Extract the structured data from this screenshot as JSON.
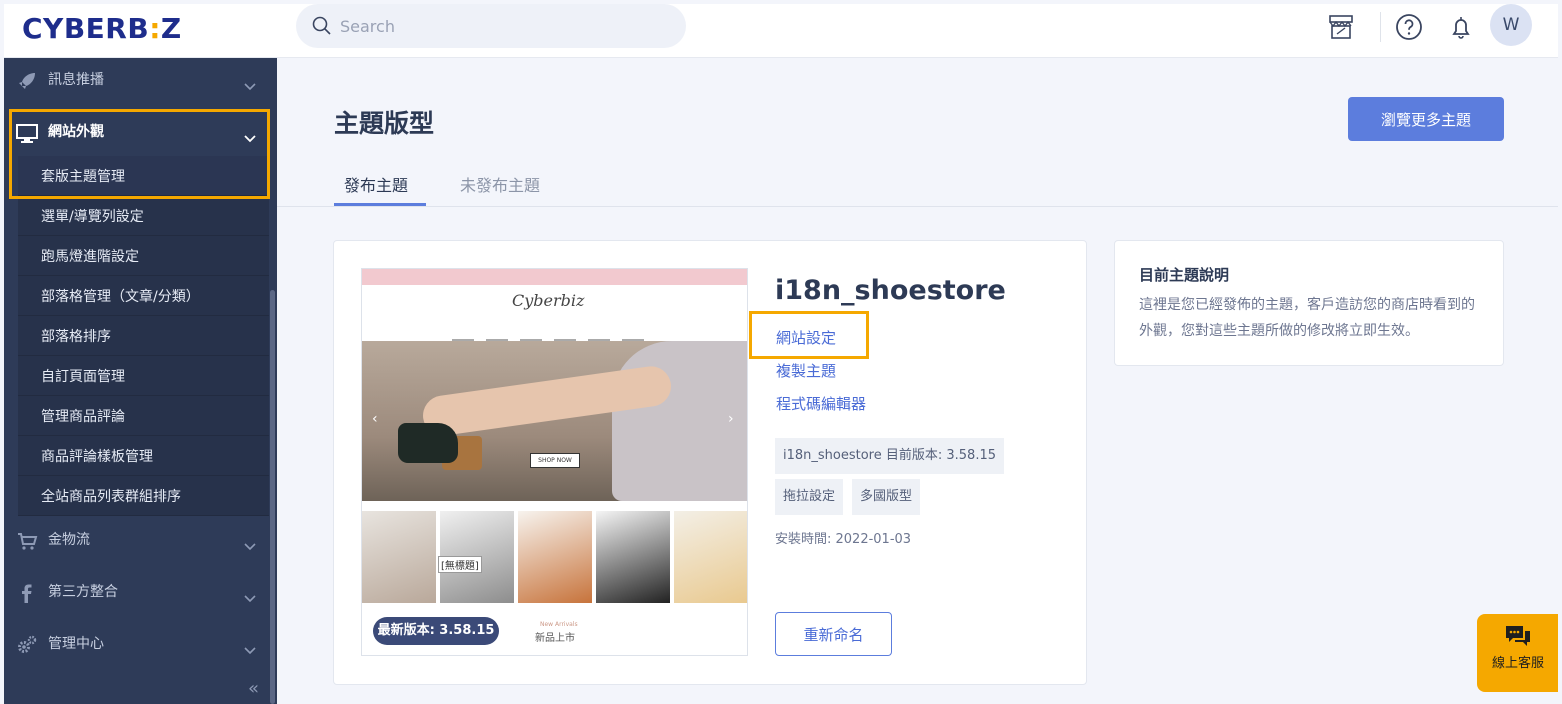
{
  "brand": {
    "logo_left": "CYBERB",
    "logo_colon": ":",
    "logo_right": "Z"
  },
  "search": {
    "placeholder": "Search"
  },
  "header": {
    "avatar_initial": "W",
    "icons": [
      "store-icon",
      "help-icon",
      "bell-icon"
    ]
  },
  "sidebar": {
    "groups": [
      {
        "label": "訊息推播",
        "icon": "rocket-icon"
      },
      {
        "label": "網站外觀",
        "icon": "monitor-icon"
      },
      {
        "label": "金物流",
        "icon": "cart-icon"
      },
      {
        "label": "第三方整合",
        "icon": "facebook-icon"
      },
      {
        "label": "管理中心",
        "icon": "gears-icon"
      }
    ],
    "sub_items": [
      "套版主題管理",
      "選單/導覽列設定",
      "跑馬燈進階設定",
      "部落格管理（文章/分類）",
      "部落格排序",
      "自訂頁面管理",
      "管理商品評論",
      "商品評論樣板管理",
      "全站商品列表群組排序"
    ],
    "collapse_label": "«"
  },
  "main": {
    "title": "主題版型",
    "more_themes_button": "瀏覽更多主題",
    "tabs": [
      {
        "label": "發布主題"
      },
      {
        "label": "未發布主題"
      }
    ]
  },
  "theme": {
    "name": "i18n_shoestore",
    "links": [
      "網站設定",
      "複製主題",
      "程式碼編輯器"
    ],
    "version_text": "i18n_shoestore 目前版本: 3.58.15",
    "tags": [
      "拖拉設定",
      "多國版型"
    ],
    "install_time": "安裝時間: 2022-01-03",
    "rename_button": "重新命名",
    "latest_badge": "最新版本: 3.58.15",
    "preview": {
      "logo": "Cyberbiz",
      "shop_now": "SHOP NOW",
      "untitled": "[無標題]",
      "new_arrivals_en": "New Arrivals",
      "new_arrivals": "新品上市"
    }
  },
  "info": {
    "title": "目前主題說明",
    "body": "這裡是您已經發佈的主題，客戶造訪您的商店時看到的外觀，您對這些主題所做的修改將立即生效。"
  },
  "chat": {
    "label": "線上客服"
  },
  "colors": {
    "accent": "#5c7ddd",
    "highlight": "#f5a800",
    "sidebar": "#2e3b58",
    "brand": "#1e2d8c"
  }
}
